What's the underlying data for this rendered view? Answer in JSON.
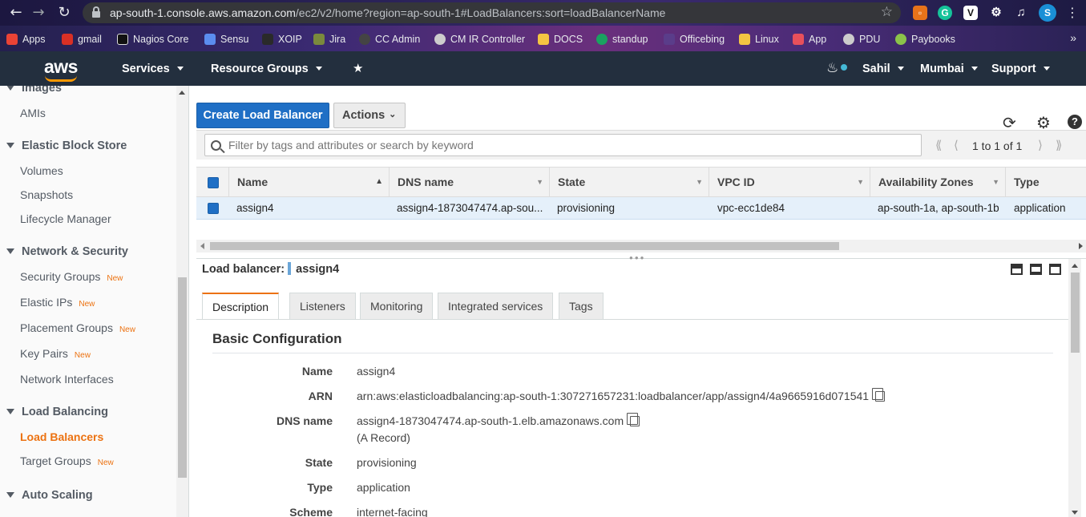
{
  "browser": {
    "url_host": "ap-south-1.console.aws.amazon.com",
    "url_path": "/ec2/v2/home?region=ap-south-1#LoadBalancers:sort=loadBalancerName",
    "profile_initial": "S",
    "bookmarks": [
      {
        "label": "Apps",
        "color": "#ea4335"
      },
      {
        "label": "gmail",
        "color": "#d93025"
      },
      {
        "label": "Nagios Core",
        "color": "#111111"
      },
      {
        "label": "Sensu",
        "color": "#5b8def"
      },
      {
        "label": "XOIP",
        "color": "#2a2a2a"
      },
      {
        "label": "Jira",
        "color": "#7a8a3c"
      },
      {
        "label": "CC Admin",
        "color": "#444444"
      },
      {
        "label": "CM IR Controller",
        "color": "#cccccc"
      },
      {
        "label": "DOCS",
        "color": "#f4c542"
      },
      {
        "label": "standup",
        "color": "#1aa260"
      },
      {
        "label": "Officebing",
        "color": "#5a3d8a"
      },
      {
        "label": "Linux",
        "color": "#f4c542"
      },
      {
        "label": "App",
        "color": "#e8505b"
      },
      {
        "label": "PDU",
        "color": "#cccccc"
      },
      {
        "label": "Paybooks",
        "color": "#8bc34a"
      }
    ]
  },
  "header": {
    "logo": "aws",
    "services": "Services",
    "resource_groups": "Resource Groups",
    "user": "Sahil",
    "region": "Mumbai",
    "support": "Support"
  },
  "sidebar": {
    "new_badge": "New",
    "groups": [
      {
        "title": "Images",
        "items": [
          {
            "label": "AMIs",
            "badge": false,
            "active": false
          }
        ]
      },
      {
        "title": "Elastic Block Store",
        "items": [
          {
            "label": "Volumes",
            "badge": false,
            "active": false
          },
          {
            "label": "Snapshots",
            "badge": false,
            "active": false
          },
          {
            "label": "Lifecycle Manager",
            "badge": false,
            "active": false
          }
        ]
      },
      {
        "title": "Network & Security",
        "items": [
          {
            "label": "Security Groups",
            "badge": true,
            "active": false
          },
          {
            "label": "Elastic IPs",
            "badge": true,
            "active": false
          },
          {
            "label": "Placement Groups",
            "badge": true,
            "active": false
          },
          {
            "label": "Key Pairs",
            "badge": true,
            "active": false
          },
          {
            "label": "Network Interfaces",
            "badge": false,
            "active": false
          }
        ]
      },
      {
        "title": "Load Balancing",
        "items": [
          {
            "label": "Load Balancers",
            "badge": false,
            "active": true
          },
          {
            "label": "Target Groups",
            "badge": true,
            "active": false
          }
        ]
      },
      {
        "title": "Auto Scaling",
        "items": []
      }
    ]
  },
  "toolbar": {
    "create_label": "Create Load Balancer",
    "actions_label": "Actions",
    "filter_placeholder": "Filter by tags and attributes or search by keyword",
    "pagination": "1 to 1 of 1"
  },
  "table": {
    "columns": [
      "Name",
      "DNS name",
      "State",
      "VPC ID",
      "Availability Zones",
      "Type"
    ],
    "rows": [
      {
        "name": "assign4",
        "dns": "assign4-1873047474.ap-sou...",
        "state": "provisioning",
        "vpc": "vpc-ecc1de84",
        "azs": "ap-south-1a, ap-south-1b",
        "type": "application"
      }
    ]
  },
  "detail": {
    "title_label": "Load balancer:",
    "title_value": "assign4",
    "tabs": [
      "Description",
      "Listeners",
      "Monitoring",
      "Integrated services",
      "Tags"
    ],
    "section_title": "Basic Configuration",
    "fields": [
      {
        "label": "Name",
        "value": "assign4"
      },
      {
        "label": "ARN",
        "value": "arn:aws:elasticloadbalancing:ap-south-1:307271657231:loadbalancer/app/assign4/4a9665916d071541"
      },
      {
        "label": "DNS name",
        "value": "assign4-1873047474.ap-south-1.elb.amazonaws.com",
        "value2": "(A Record)"
      },
      {
        "label": "State",
        "value": "provisioning"
      },
      {
        "label": "Type",
        "value": "application"
      },
      {
        "label": "Scheme",
        "value": "internet-facing"
      }
    ]
  }
}
